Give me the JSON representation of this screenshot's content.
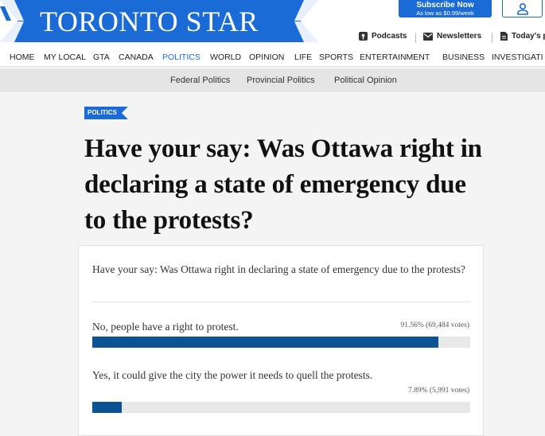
{
  "brand": {
    "name": "TORONTO STAR",
    "color": "#1a6bd6"
  },
  "subscribe": {
    "line1": "Subscribe Now",
    "line2": "As low as $0.99/week"
  },
  "account": {
    "icon": "user-icon"
  },
  "utility_nav": [
    {
      "label": "Podcasts",
      "icon": "podcast-icon"
    },
    {
      "label": "Newsletters",
      "icon": "mail-icon"
    },
    {
      "label": "Today's p",
      "icon": "newspaper-icon"
    }
  ],
  "main_nav": [
    "HOME",
    "MY LOCAL",
    "GTA",
    "CANADA",
    "POLITICS",
    "WORLD",
    "OPINION",
    "LIFE",
    "SPORTS",
    "ENTERTAINMENT",
    "BUSINESS",
    "INVESTIGATI"
  ],
  "main_nav_active": "POLITICS",
  "sub_nav": [
    "Federal Politics",
    "Provincial Politics",
    "Political Opinion"
  ],
  "article": {
    "tag": "POLITICS",
    "headline": "Have your say: Was Ottawa right in declaring a state of emergency due to the protests?"
  },
  "poll": {
    "question": "Have your say: Was Ottawa right in declaring a state of emergency due to the protests?",
    "options": [
      {
        "label": "No, people have a right to protest.",
        "percent": "91.56%",
        "votes": "(69,484 votes)",
        "fraction": 0.9156
      },
      {
        "label": "Yes, it could give the city the power it needs to quell the protests.",
        "percent": "7.89%",
        "votes": "(5,991 votes)",
        "fraction": 0.0789
      }
    ],
    "bar_color": "#0c5394"
  }
}
